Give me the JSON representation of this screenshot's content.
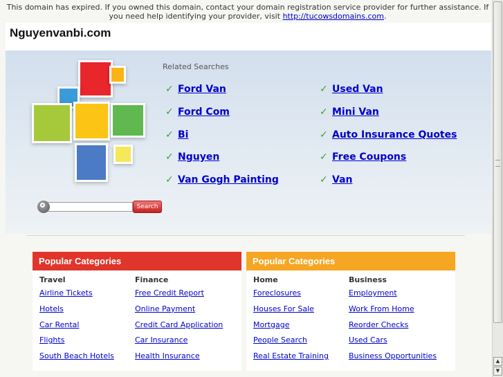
{
  "notice": {
    "text": "This domain has expired. If you owned this domain, contact your domain registration service provider for further assistance. If you need help identifying your provider, visit",
    "link": "http://tucowsdomains.com",
    "end": "."
  },
  "site": {
    "title": "Nguyenvanbi.com"
  },
  "related": {
    "title": "Related Searches",
    "left": [
      "Ford Van",
      "Ford Com",
      "Bi",
      "Nguyen",
      "Van Gogh Painting"
    ],
    "right": [
      "Used Van",
      "Mini Van",
      "Auto Insurance Quotes",
      "Free Coupons",
      "Van"
    ]
  },
  "search": {
    "button": "Search",
    "value": ""
  },
  "colors": {
    "red_panel": "#e0352b",
    "orange_panel": "#f5a623",
    "link": "#0000cc",
    "check": "#3aa33a"
  },
  "panels": [
    {
      "title": "Popular Categories",
      "columns": [
        {
          "heading": "Travel",
          "links": [
            "Airline Tickets",
            "Hotels",
            "Car Rental",
            "Flights",
            "South Beach Hotels"
          ]
        },
        {
          "heading": "Finance",
          "links": [
            "Free Credit Report",
            "Online Payment",
            "Credit Card Application",
            "Car Insurance",
            "Health Insurance"
          ]
        }
      ]
    },
    {
      "title": "Popular Categories",
      "columns": [
        {
          "heading": "Home",
          "links": [
            "Foreclosures",
            "Houses For Sale",
            "Mortgage",
            "People Search",
            "Real Estate Training"
          ]
        },
        {
          "heading": "Business",
          "links": [
            "Employment",
            "Work From Home",
            "Reorder Checks",
            "Used Cars",
            "Business Opportunities"
          ]
        }
      ]
    }
  ]
}
